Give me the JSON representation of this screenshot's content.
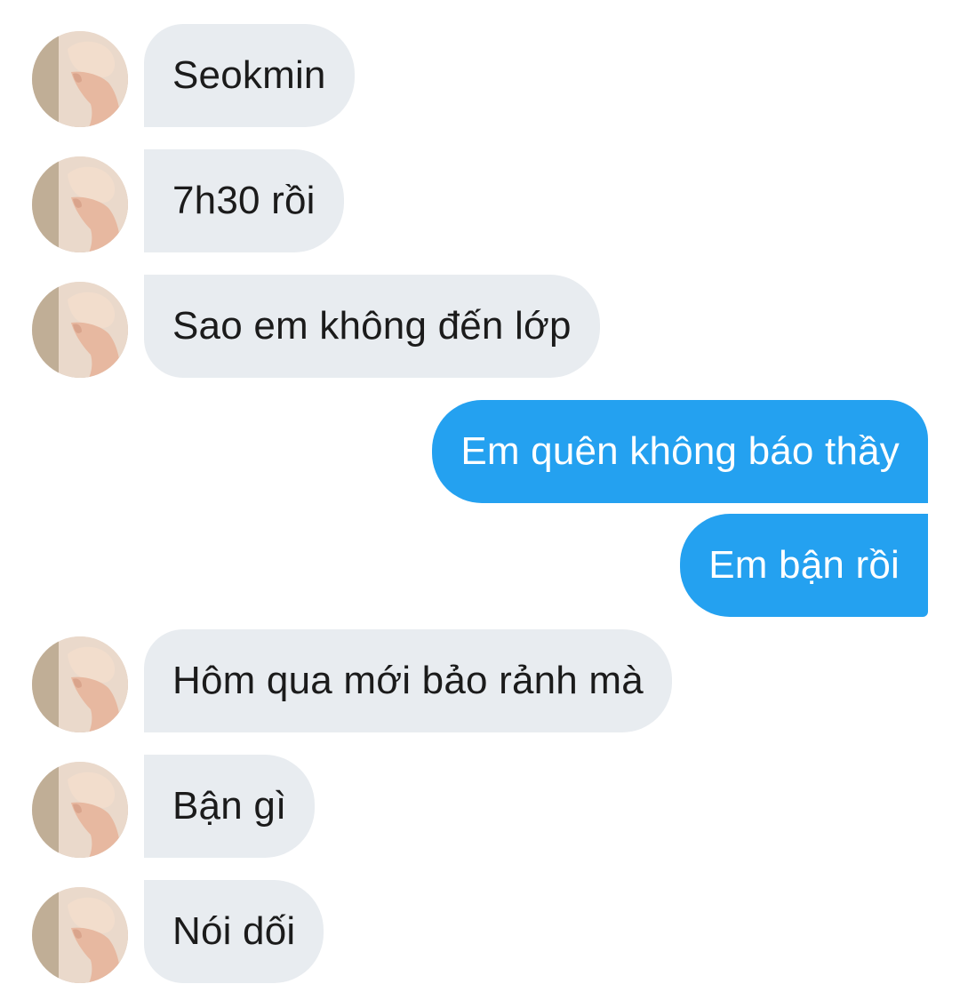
{
  "messages": [
    {
      "side": "in",
      "text": "Seokmin"
    },
    {
      "side": "in",
      "text": "7h30 rồi"
    },
    {
      "side": "in",
      "text": "Sao em không đến lớp"
    },
    {
      "side": "out",
      "text": "Em quên không báo thầy"
    },
    {
      "side": "out",
      "text": "Em bận rồi"
    },
    {
      "side": "in",
      "text": "Hôm qua mới bảo rảnh mà"
    },
    {
      "side": "in",
      "text": "Bận gì"
    },
    {
      "side": "in",
      "text": "Nói dối"
    }
  ],
  "colors": {
    "incoming_bubble": "#e8ecf0",
    "outgoing_bubble": "#24a1f0",
    "incoming_text": "#1b1b1b",
    "outgoing_text": "#ffffff"
  },
  "icons": {
    "avatar": "contact-avatar-photo"
  }
}
